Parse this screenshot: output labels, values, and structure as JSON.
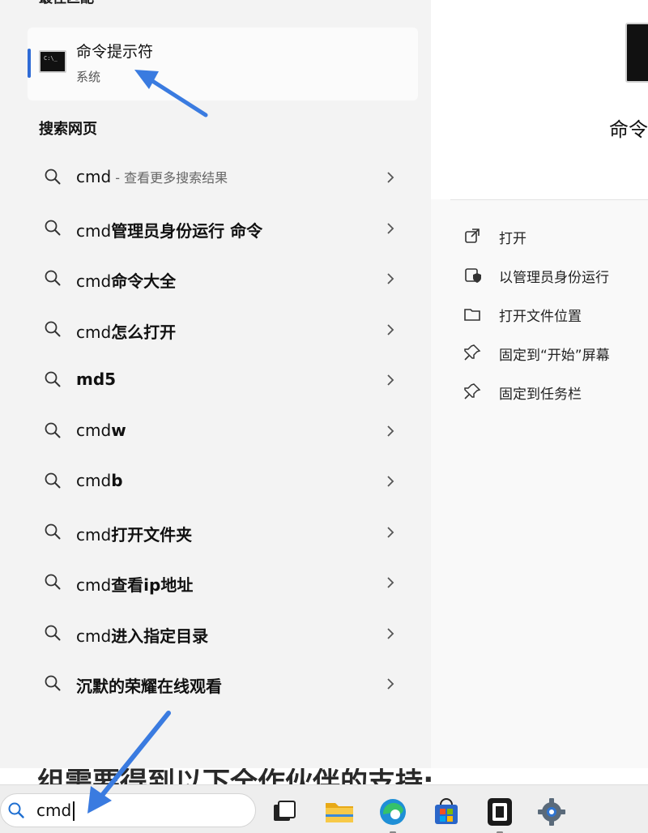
{
  "best_match": {
    "heading": "最佳匹配",
    "app_name": "命令提示符",
    "app_type": "系统",
    "icon": "cmd-icon"
  },
  "web_search": {
    "heading": "搜索网页",
    "results": [
      {
        "plain": "cmd",
        "bold": "",
        "hint": " - 查看更多搜索结果"
      },
      {
        "plain": "cmd",
        "bold": "管理员身份运行 命令",
        "hint": ""
      },
      {
        "plain": "cmd",
        "bold": "命令大全",
        "hint": ""
      },
      {
        "plain": "cmd",
        "bold": "怎么打开",
        "hint": ""
      },
      {
        "plain": "",
        "bold": "md5",
        "hint": ""
      },
      {
        "plain": "cmd",
        "bold": "w",
        "hint": ""
      },
      {
        "plain": "cmd",
        "bold": "b",
        "hint": ""
      },
      {
        "plain": "cmd",
        "bold": "打开文件夹",
        "hint": ""
      },
      {
        "plain": "cmd",
        "bold": "查看ip地址",
        "hint": ""
      },
      {
        "plain": "cmd",
        "bold": "进入指定目录",
        "hint": ""
      },
      {
        "plain": "",
        "bold": "沉默的荣耀在线观看",
        "hint": ""
      }
    ]
  },
  "preview": {
    "name": "命令",
    "actions": [
      {
        "label": "打开",
        "icon": "open-external-icon"
      },
      {
        "label": "以管理员身份运行",
        "icon": "shield-icon"
      },
      {
        "label": "打开文件位置",
        "icon": "folder-icon"
      },
      {
        "label": "固定到“开始”屏幕",
        "icon": "pin-icon"
      },
      {
        "label": "固定到任务栏",
        "icon": "pin-icon"
      }
    ]
  },
  "background_text": "组需要得到以下全作伙伴的支持:",
  "taskbar": {
    "search_value": "cmd",
    "apps": [
      "task-view-icon",
      "file-explorer-icon",
      "edge-icon",
      "store-icon",
      "terminal-app-icon",
      "settings-icon"
    ]
  },
  "colors": {
    "accent": "#2f6bd6",
    "annotation_arrow": "#3a7be0"
  }
}
